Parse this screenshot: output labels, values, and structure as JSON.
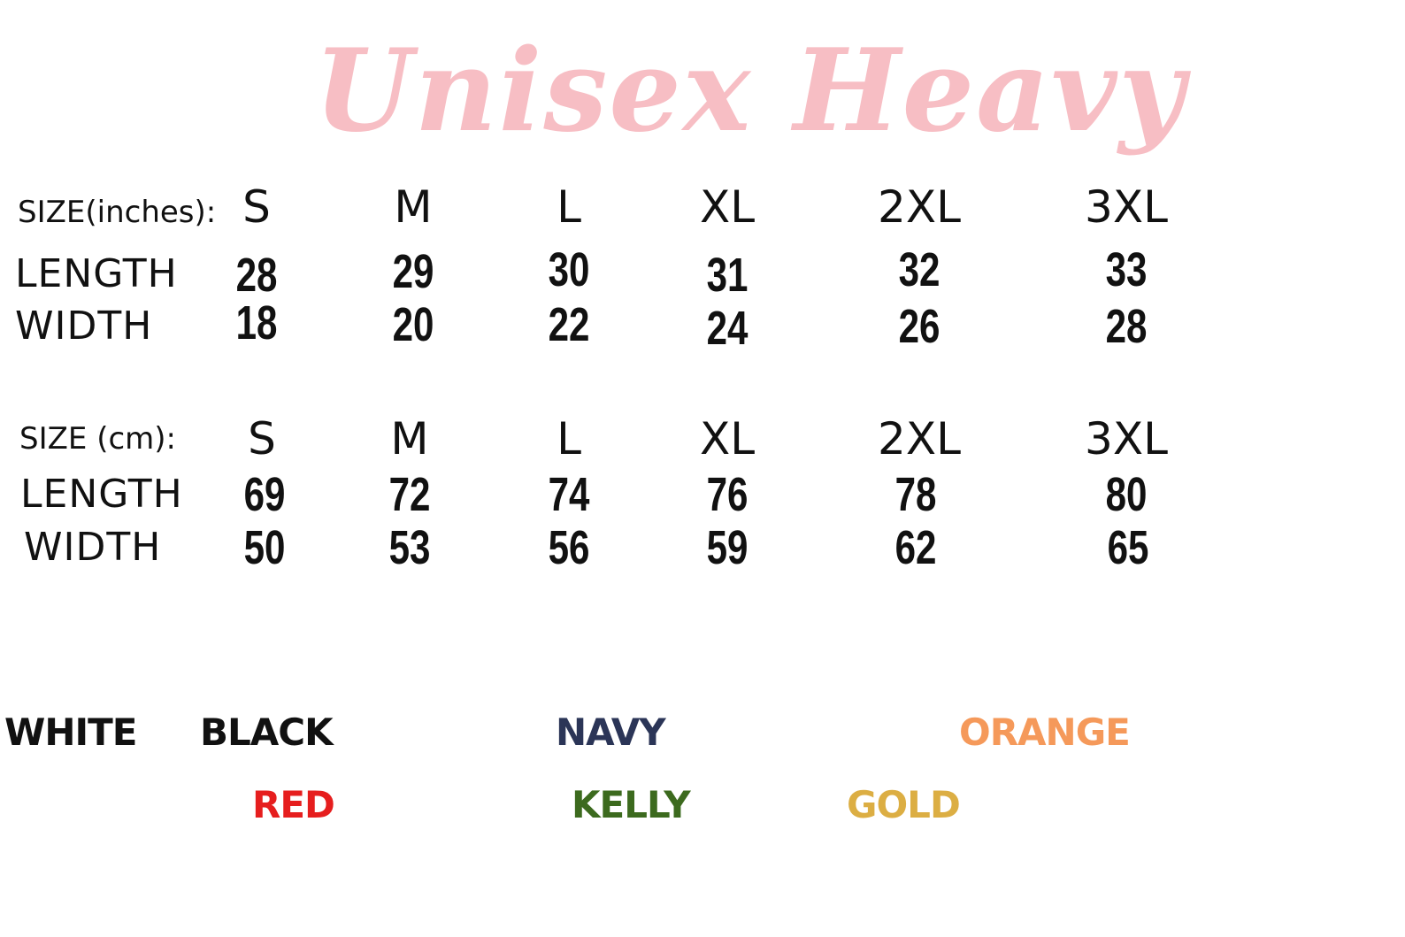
{
  "title": "Unisex Heavy",
  "inches": {
    "label": "SIZE(inches):",
    "sizes": [
      "S",
      "M",
      "L",
      "XL",
      "2XL",
      "3XL"
    ],
    "length_label": "LENGTH",
    "width_label": "WIDTH",
    "length": [
      "28",
      "29",
      "30",
      "31",
      "32",
      "33"
    ],
    "width": [
      "18",
      "20",
      "22",
      "24",
      "26",
      "28"
    ]
  },
  "cm": {
    "label": "SIZE (cm):",
    "sizes": [
      "S",
      "M",
      "L",
      "XL",
      "2XL",
      "3XL"
    ],
    "length_label": "LENGTH",
    "width_label": "WIDTH",
    "length": [
      "69",
      "72",
      "74",
      "76",
      "78",
      "80"
    ],
    "width": [
      "50",
      "53",
      "56",
      "59",
      "62",
      "65"
    ]
  },
  "colors": [
    {
      "name": "WHITE",
      "hex": "#111111"
    },
    {
      "name": "BLACK",
      "hex": "#111111"
    },
    {
      "name": "NAVY",
      "hex": "#2b3557"
    },
    {
      "name": "ORANGE",
      "hex": "#f5995a"
    },
    {
      "name": "RED",
      "hex": "#e61e1e"
    },
    {
      "name": "KELLY",
      "hex": "#3c6a1e"
    },
    {
      "name": "GOLD",
      "hex": "#dcae43"
    }
  ]
}
